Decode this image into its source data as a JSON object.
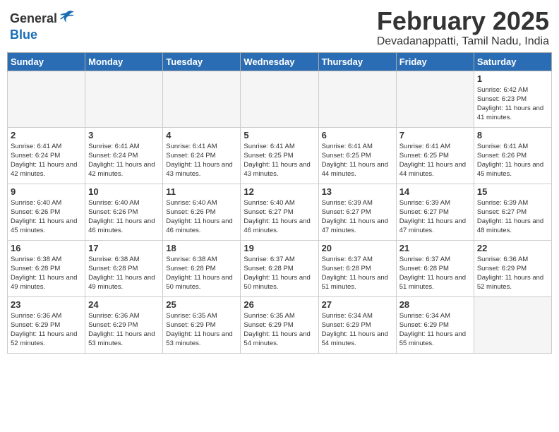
{
  "header": {
    "logo": {
      "general": "General",
      "blue": "Blue"
    },
    "title": "February 2025",
    "location": "Devadanappatti, Tamil Nadu, India"
  },
  "weekdays": [
    "Sunday",
    "Monday",
    "Tuesday",
    "Wednesday",
    "Thursday",
    "Friday",
    "Saturday"
  ],
  "weeks": [
    [
      {
        "day": "",
        "empty": true
      },
      {
        "day": "",
        "empty": true
      },
      {
        "day": "",
        "empty": true
      },
      {
        "day": "",
        "empty": true
      },
      {
        "day": "",
        "empty": true
      },
      {
        "day": "",
        "empty": true
      },
      {
        "day": "1",
        "sunrise": "6:42 AM",
        "sunset": "6:23 PM",
        "daylight": "11 hours and 41 minutes."
      }
    ],
    [
      {
        "day": "2",
        "sunrise": "6:41 AM",
        "sunset": "6:24 PM",
        "daylight": "11 hours and 42 minutes."
      },
      {
        "day": "3",
        "sunrise": "6:41 AM",
        "sunset": "6:24 PM",
        "daylight": "11 hours and 42 minutes."
      },
      {
        "day": "4",
        "sunrise": "6:41 AM",
        "sunset": "6:24 PM",
        "daylight": "11 hours and 43 minutes."
      },
      {
        "day": "5",
        "sunrise": "6:41 AM",
        "sunset": "6:25 PM",
        "daylight": "11 hours and 43 minutes."
      },
      {
        "day": "6",
        "sunrise": "6:41 AM",
        "sunset": "6:25 PM",
        "daylight": "11 hours and 44 minutes."
      },
      {
        "day": "7",
        "sunrise": "6:41 AM",
        "sunset": "6:25 PM",
        "daylight": "11 hours and 44 minutes."
      },
      {
        "day": "8",
        "sunrise": "6:41 AM",
        "sunset": "6:26 PM",
        "daylight": "11 hours and 45 minutes."
      }
    ],
    [
      {
        "day": "9",
        "sunrise": "6:40 AM",
        "sunset": "6:26 PM",
        "daylight": "11 hours and 45 minutes."
      },
      {
        "day": "10",
        "sunrise": "6:40 AM",
        "sunset": "6:26 PM",
        "daylight": "11 hours and 46 minutes."
      },
      {
        "day": "11",
        "sunrise": "6:40 AM",
        "sunset": "6:26 PM",
        "daylight": "11 hours and 46 minutes."
      },
      {
        "day": "12",
        "sunrise": "6:40 AM",
        "sunset": "6:27 PM",
        "daylight": "11 hours and 46 minutes."
      },
      {
        "day": "13",
        "sunrise": "6:39 AM",
        "sunset": "6:27 PM",
        "daylight": "11 hours and 47 minutes."
      },
      {
        "day": "14",
        "sunrise": "6:39 AM",
        "sunset": "6:27 PM",
        "daylight": "11 hours and 47 minutes."
      },
      {
        "day": "15",
        "sunrise": "6:39 AM",
        "sunset": "6:27 PM",
        "daylight": "11 hours and 48 minutes."
      }
    ],
    [
      {
        "day": "16",
        "sunrise": "6:38 AM",
        "sunset": "6:28 PM",
        "daylight": "11 hours and 49 minutes."
      },
      {
        "day": "17",
        "sunrise": "6:38 AM",
        "sunset": "6:28 PM",
        "daylight": "11 hours and 49 minutes."
      },
      {
        "day": "18",
        "sunrise": "6:38 AM",
        "sunset": "6:28 PM",
        "daylight": "11 hours and 50 minutes."
      },
      {
        "day": "19",
        "sunrise": "6:37 AM",
        "sunset": "6:28 PM",
        "daylight": "11 hours and 50 minutes."
      },
      {
        "day": "20",
        "sunrise": "6:37 AM",
        "sunset": "6:28 PM",
        "daylight": "11 hours and 51 minutes."
      },
      {
        "day": "21",
        "sunrise": "6:37 AM",
        "sunset": "6:28 PM",
        "daylight": "11 hours and 51 minutes."
      },
      {
        "day": "22",
        "sunrise": "6:36 AM",
        "sunset": "6:29 PM",
        "daylight": "11 hours and 52 minutes."
      }
    ],
    [
      {
        "day": "23",
        "sunrise": "6:36 AM",
        "sunset": "6:29 PM",
        "daylight": "11 hours and 52 minutes."
      },
      {
        "day": "24",
        "sunrise": "6:36 AM",
        "sunset": "6:29 PM",
        "daylight": "11 hours and 53 minutes."
      },
      {
        "day": "25",
        "sunrise": "6:35 AM",
        "sunset": "6:29 PM",
        "daylight": "11 hours and 53 minutes."
      },
      {
        "day": "26",
        "sunrise": "6:35 AM",
        "sunset": "6:29 PM",
        "daylight": "11 hours and 54 minutes."
      },
      {
        "day": "27",
        "sunrise": "6:34 AM",
        "sunset": "6:29 PM",
        "daylight": "11 hours and 54 minutes."
      },
      {
        "day": "28",
        "sunrise": "6:34 AM",
        "sunset": "6:29 PM",
        "daylight": "11 hours and 55 minutes."
      },
      {
        "day": "",
        "empty": true
      }
    ]
  ]
}
